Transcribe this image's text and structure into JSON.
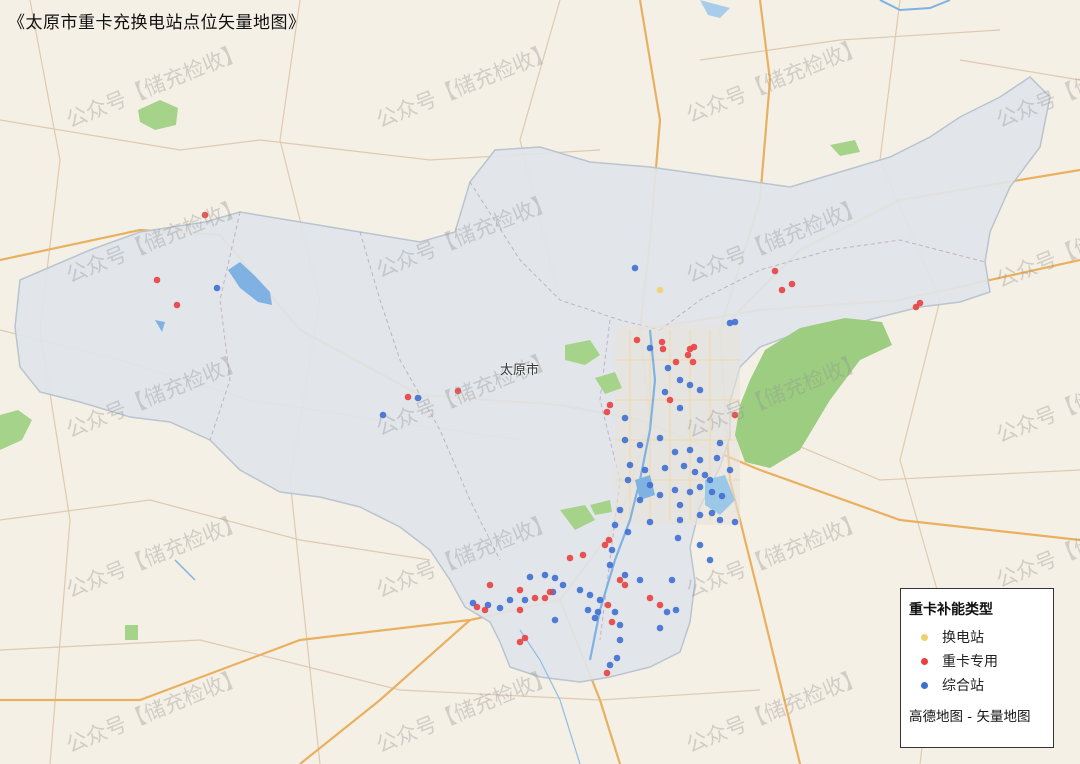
{
  "map": {
    "title": "《太原市重卡充换电站点位矢量地图》",
    "city_label": "太原市",
    "watermark_text": "公众号【储充检收】",
    "colors": {
      "background": "#f4f0e6",
      "region_fill": "#dfe5ea",
      "region_stroke": "#b9c4cf",
      "water": "#7fb2e2",
      "park": "#a6d38a",
      "highway": "#e9b060",
      "road": "#d7b08e",
      "boundary": "#b39bb8"
    }
  },
  "legend": {
    "title": "重卡补能类型",
    "items": [
      {
        "label": "换电站",
        "color": "#efd070"
      },
      {
        "label": "重卡专用",
        "color": "#e84040"
      },
      {
        "label": "综合站",
        "color": "#3f6fd1"
      }
    ],
    "source": "高德地图 - 矢量地图"
  }
}
